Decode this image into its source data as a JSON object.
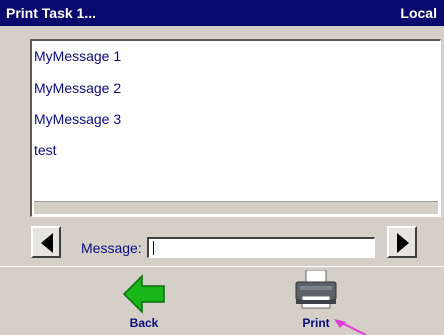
{
  "window": {
    "title": "Print Task 1...",
    "location": "Local"
  },
  "list": {
    "items": [
      "MyMessage 1",
      "MyMessage 2",
      "MyMessage 3",
      "test"
    ]
  },
  "message": {
    "label": "Message:",
    "value": ""
  },
  "buttons": {
    "back_label": "Back",
    "print_label": "Print"
  },
  "icons": {
    "prev": "left-arrow-icon",
    "next": "right-arrow-icon",
    "back": "green-back-arrow-icon",
    "print": "printer-icon"
  },
  "colors": {
    "title_bar": "#09096e",
    "text": "#0b0b80",
    "back_arrow": "#19b619",
    "cursor": "#e43ad6"
  }
}
